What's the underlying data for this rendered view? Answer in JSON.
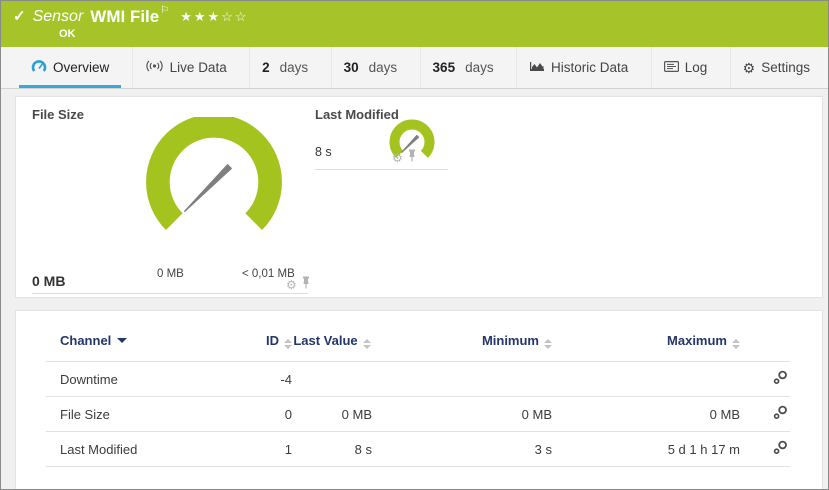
{
  "sensor_header": {
    "check_icon": "✓",
    "type_label": "Sensor",
    "name": "WMI File",
    "flag_icon": "⚐",
    "rating_filled": "★★★",
    "rating_empty": "☆☆",
    "status": "OK"
  },
  "tabs": [
    {
      "label": "Overview",
      "icon": "gauge-icon",
      "active": true
    },
    {
      "label": "Live Data",
      "icon": "live-data-icon"
    },
    {
      "value": "2",
      "label": "days"
    },
    {
      "value": "30",
      "label": "days"
    },
    {
      "value": "365",
      "label": "days"
    },
    {
      "label": "Historic Data",
      "icon": "historic-data-icon"
    },
    {
      "label": "Log",
      "icon": "log-icon"
    },
    {
      "label": "Settings",
      "icon": "gear-icon",
      "gear_glyph": "⚙"
    }
  ],
  "gauges": {
    "file_size": {
      "title": "File Size",
      "value": "0 MB",
      "scale_min": "0 MB",
      "scale_max": "< 0,01 MB"
    },
    "last_modified": {
      "title": "Last Modified",
      "value": "8 s"
    },
    "gear_glyph": "⚙"
  },
  "channel_table": {
    "columns": {
      "channel": "Channel",
      "id": "ID",
      "last_value": "Last Value",
      "minimum": "Minimum",
      "maximum": "Maximum"
    },
    "rows": [
      {
        "channel": "Downtime",
        "id": "-4",
        "last_value": "",
        "minimum": "",
        "maximum": ""
      },
      {
        "channel": "File Size",
        "id": "0",
        "last_value": "0 MB",
        "minimum": "0 MB",
        "maximum": "0 MB"
      },
      {
        "channel": "Last Modified",
        "id": "1",
        "last_value": "8 s",
        "minimum": "3 s",
        "maximum": "5 d 1 h 17 m"
      }
    ]
  },
  "colors": {
    "status_green": "#a6c42a",
    "accent_blue": "#35a8dc",
    "header_navy": "#24366b",
    "needle_gray": "#7f7f7f"
  }
}
